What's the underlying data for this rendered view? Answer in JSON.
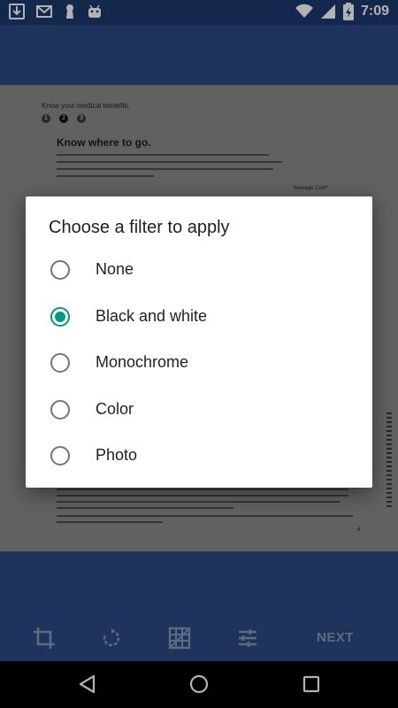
{
  "status_bar": {
    "time": "7:09",
    "icons": [
      "download-icon",
      "gmail-icon",
      "keyhole-icon",
      "android-icon",
      "wifi-icon",
      "signal-icon",
      "battery-charging-icon"
    ]
  },
  "document": {
    "heading": "Know your medical benefits.",
    "steps": [
      "1",
      "2",
      "3"
    ],
    "title": "Know where to go.",
    "average_cost_label": "Average Cost*",
    "page_number": "4"
  },
  "dialog": {
    "title": "Choose a filter to apply",
    "selected": "Black and white",
    "options": [
      {
        "label": "None",
        "checked": false
      },
      {
        "label": "Black and white",
        "checked": true
      },
      {
        "label": "Monochrome",
        "checked": false
      },
      {
        "label": "Color",
        "checked": false
      },
      {
        "label": "Photo",
        "checked": false
      }
    ]
  },
  "toolbar": {
    "tools": [
      "crop-icon",
      "rotate-icon",
      "filter-grid-icon",
      "adjust-sliders-icon"
    ],
    "next_label": "NEXT"
  },
  "nav_bar": {
    "buttons": [
      "back-icon",
      "home-icon",
      "recents-icon"
    ]
  },
  "colors": {
    "status_bar": "#1c3a6e",
    "app_bar": "#2c4b85",
    "accent": "#009688"
  }
}
